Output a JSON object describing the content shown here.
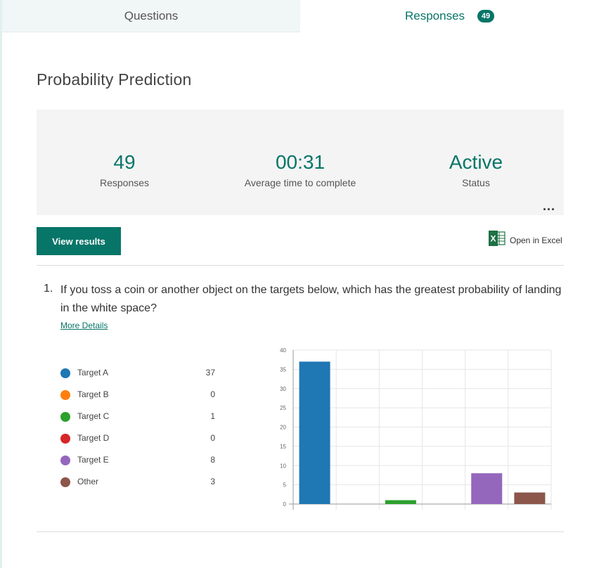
{
  "tabs": {
    "questions_label": "Questions",
    "responses_label": "Responses",
    "responses_count": "49"
  },
  "form": {
    "title": "Probability Prediction"
  },
  "summary": {
    "responses_value": "49",
    "responses_label": "Responses",
    "avg_time_value": "00:31",
    "avg_time_label": "Average time to complete",
    "status_value": "Active",
    "status_label": "Status",
    "more_label": "..."
  },
  "actions": {
    "view_results_label": "View results",
    "open_excel_label": "Open in Excel",
    "excel_icon_letter": "X"
  },
  "question": {
    "number": "1.",
    "text": "If you toss a coin or another object on the targets below, which has the greatest probability of landing in the white space?",
    "more_details_label": "More Details"
  },
  "legend": [
    {
      "label": "Target A",
      "count": "37",
      "color": "#1f77b4"
    },
    {
      "label": "Target B",
      "count": "0",
      "color": "#ff7f0e"
    },
    {
      "label": "Target C",
      "count": "1",
      "color": "#2ca02c"
    },
    {
      "label": "Target D",
      "count": "0",
      "color": "#d62728"
    },
    {
      "label": "Target E",
      "count": "8",
      "color": "#9467bd"
    },
    {
      "label": "Other",
      "count": "3",
      "color": "#8c564b"
    }
  ],
  "chart_data": {
    "type": "bar",
    "categories": [
      "Target A",
      "Target B",
      "Target C",
      "Target D",
      "Target E",
      "Other"
    ],
    "values": [
      37,
      0,
      1,
      0,
      8,
      3
    ],
    "colors": [
      "#1f77b4",
      "#ff7f0e",
      "#2ca02c",
      "#d62728",
      "#9467bd",
      "#8c564b"
    ],
    "ylim": [
      0,
      40
    ],
    "yticks": [
      0,
      5,
      10,
      15,
      20,
      25,
      30,
      35,
      40
    ],
    "grid": true,
    "title": "",
    "xlabel": "",
    "ylabel": ""
  }
}
